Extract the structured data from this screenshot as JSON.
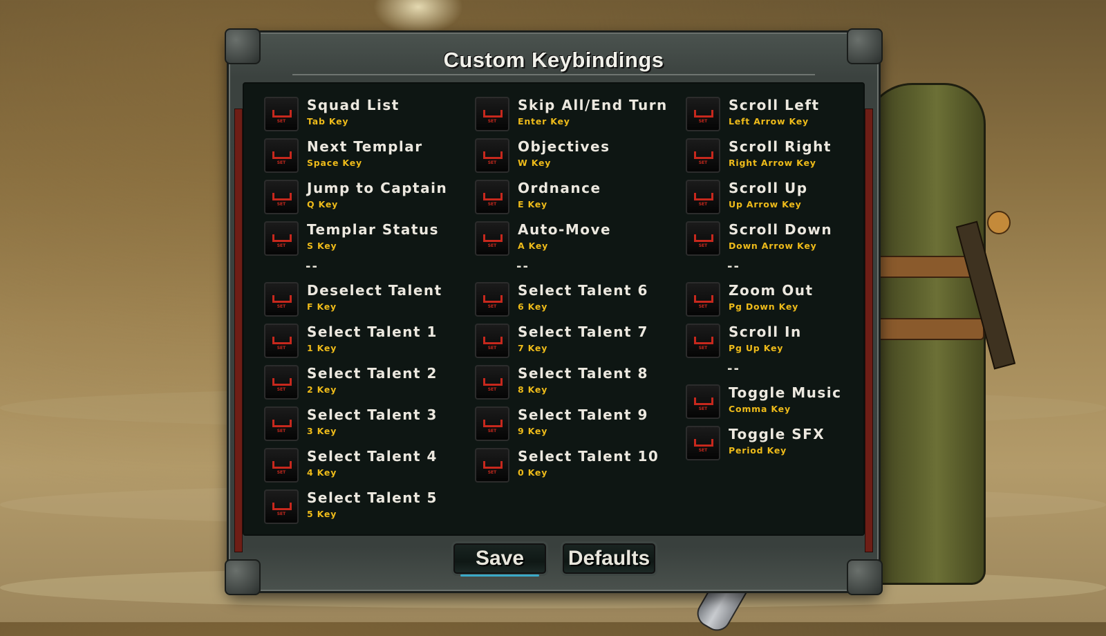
{
  "dialog": {
    "title": "Custom Keybindings",
    "set_label": "SET",
    "separator": "--",
    "save_label": "Save",
    "defaults_label": "Defaults"
  },
  "bindings": {
    "col1": [
      {
        "action": "Squad List",
        "key": "Tab Key"
      },
      {
        "action": "Next Templar",
        "key": "Space Key"
      },
      {
        "action": "Jump to Captain",
        "key": "Q Key"
      },
      {
        "action": "Templar Status",
        "key": "S Key"
      },
      {
        "action": "Deselect Talent",
        "key": "F Key"
      },
      {
        "action": "Select Talent 1",
        "key": "1 Key"
      },
      {
        "action": "Select Talent 2",
        "key": "2 Key"
      },
      {
        "action": "Select Talent 3",
        "key": "3 Key"
      },
      {
        "action": "Select Talent 4",
        "key": "4 Key"
      },
      {
        "action": "Select Talent 5",
        "key": "5 Key"
      }
    ],
    "col2": [
      {
        "action": "Skip All/End Turn",
        "key": "Enter Key"
      },
      {
        "action": "Objectives",
        "key": "W Key"
      },
      {
        "action": "Ordnance",
        "key": "E Key"
      },
      {
        "action": "Auto-Move",
        "key": "A Key"
      },
      {
        "action": "Select Talent 6",
        "key": "6 Key"
      },
      {
        "action": "Select Talent 7",
        "key": "7 Key"
      },
      {
        "action": "Select Talent 8",
        "key": "8 Key"
      },
      {
        "action": "Select Talent 9",
        "key": "9 Key"
      },
      {
        "action": "Select Talent 10",
        "key": "0 Key"
      }
    ],
    "col3": [
      {
        "action": "Scroll Left",
        "key": "Left Arrow Key"
      },
      {
        "action": "Scroll Right",
        "key": "Right Arrow Key"
      },
      {
        "action": "Scroll Up",
        "key": "Up Arrow Key"
      },
      {
        "action": "Scroll Down",
        "key": "Down Arrow Key"
      },
      {
        "action": "Zoom Out",
        "key": "Pg Down Key"
      },
      {
        "action": "Scroll In",
        "key": "Pg Up Key"
      },
      {
        "action": "Toggle Music",
        "key": "Comma Key"
      },
      {
        "action": "Toggle SFX",
        "key": "Period Key"
      }
    ]
  },
  "colors": {
    "action_text": "#ece8df",
    "key_text": "#eebb1a",
    "set_icon": "#c7281d"
  }
}
